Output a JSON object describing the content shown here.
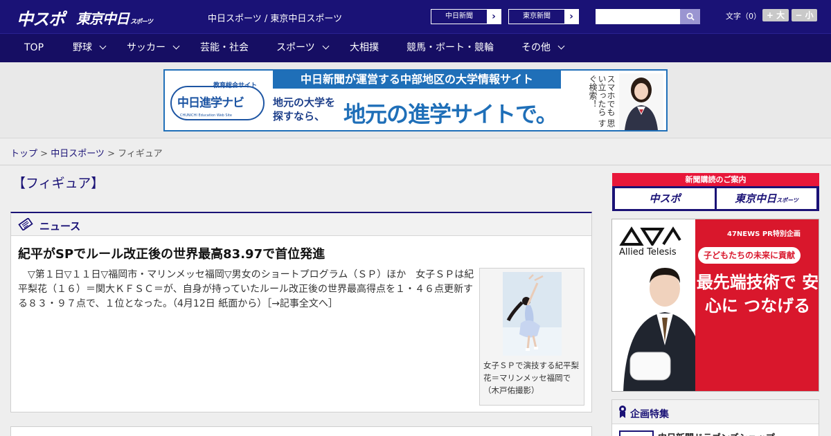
{
  "header": {
    "logo_chuspo": "中スポ",
    "logo_tokyo": "東京中日",
    "logo_tokyo_small": "スポーツ",
    "tagline": "中日スポーツ / 東京中日スポーツ",
    "paper_btn_1": "中日新聞",
    "paper_btn_2": "東京新聞",
    "arrow": "›",
    "search_placeholder": "",
    "fontsize_label": "文字（0）",
    "fontsize_big": "+ 大",
    "fontsize_small": "− 小"
  },
  "nav": {
    "items": [
      {
        "label": "TOP",
        "has_dropdown": false
      },
      {
        "label": "野球",
        "has_dropdown": true
      },
      {
        "label": "サッカー",
        "has_dropdown": true
      },
      {
        "label": "芸能・社会",
        "has_dropdown": false
      },
      {
        "label": "スポーツ",
        "has_dropdown": true
      },
      {
        "label": "大相撲",
        "has_dropdown": false
      },
      {
        "label": "競馬・ボート・競輪",
        "has_dropdown": false
      },
      {
        "label": "その他",
        "has_dropdown": true
      }
    ]
  },
  "banner": {
    "logo_top": "教育総合サイト",
    "logo_main": "中日進学ナビ",
    "logo_sub": "CHUNICHI Education Web Site",
    "headline": "中日新聞が運営する中部地区の大学情報サイト",
    "sub_line1": "地元の大学を",
    "sub_line2": "探すなら、",
    "main": "地元の進学サイトで。",
    "vertical": "スマホでも 思い立ったら すぐ検索！"
  },
  "breadcrumb": {
    "top": "トップ",
    "sep": " > ",
    "section": "中日スポーツ",
    "current": "フィギュア"
  },
  "page": {
    "title": "【フィギュア】"
  },
  "news": {
    "section_label": "ニュース",
    "headline": "紀平がSPでルール改正後の世界最高83.97で首位発進",
    "body": "▽第１日▽１１日▽福岡市・マリンメッセ福岡▽男女のショートプログラム（ＳＰ）ほか　女子ＳＰは紀平梨花（１６）＝関大ＫＦＳＣ＝が、自身が持っていたルール改正後の世界最高得点を１・４６点更新する８３・９７点で、１位となった。（4月12日 紙面から）［→記事全文へ］",
    "caption": "女子ＳＰで演技する紀平梨花＝マリンメッセ福岡で（木戸佑撮影）"
  },
  "sidebar": {
    "subscribe_head": "新聞購読のご案内",
    "subscribe_btn_1": "中スポ",
    "subscribe_btn_2": "東京中日",
    "subscribe_btn_2_small": "スポーツ",
    "ad_brand": "Allied Telesis",
    "ad_top": "47NEWS PR特別企画",
    "ad_pill": "子どもたちの未来に貢献",
    "ad_big": "最先端技術で 安心に つなげる",
    "feature_label": "企画特集",
    "feature_item": "中日新聞ドラゴンズショップ"
  },
  "colors": {
    "brand_navy": "#1a1276",
    "nav_navy": "#160e63",
    "accent_red": "#e8173a",
    "banner_blue": "#1f6fb8"
  }
}
